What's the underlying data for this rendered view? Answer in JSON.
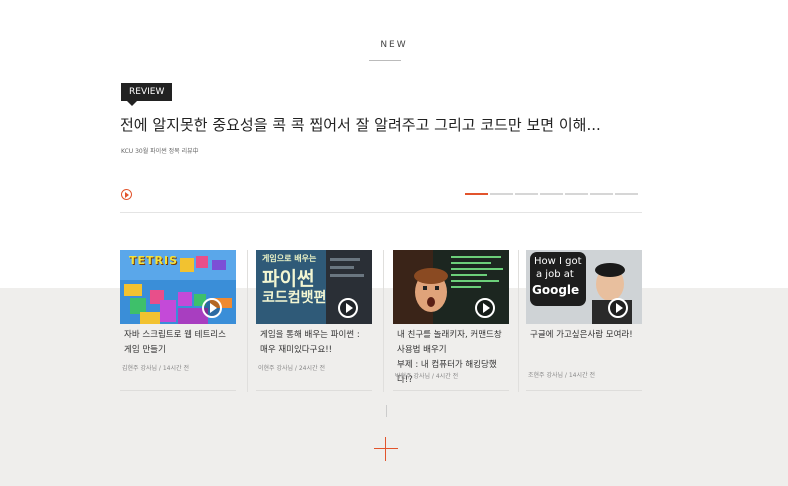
{
  "section": {
    "title": "NEW"
  },
  "featured": {
    "badge": "REVIEW",
    "headline": "전에 알지못한 중요성을 콕 콕 찝어서 잘 알려주고 그리고 코드만 보면 이해...",
    "meta": "KCU 30월 파이썬 정복 리뷰中"
  },
  "pager": {
    "pages": 7,
    "active": 0
  },
  "cards": [
    {
      "thumb_text": "TETRIS",
      "title_line1": "자바 스크립트로 웹 테트리스",
      "title_line2": "게임 만들기",
      "title_line3": "",
      "author": "김현주 강사님 / 14시간 전"
    },
    {
      "thumb_text_top": "게임으로 배우는",
      "thumb_text_main": "파이썬",
      "thumb_text_sub": "코드컴뱃편",
      "title_line1": "게임을 통해 배우는 파이썬 :",
      "title_line2": "매우 재미있다구요!!",
      "title_line3": "",
      "author": "이현주 강사님 / 24시간 전"
    },
    {
      "title_line1": "내 친구를 놀래키자, 커맨드창",
      "title_line2": "사용법 배우기",
      "title_line3": "부제 : 내 컴퓨터가 해킹당했다!?",
      "author": "박현주 강사님 / 4시간 전"
    },
    {
      "thumb_text_1": "How I got",
      "thumb_text_2": "a job at",
      "thumb_text_3": "Google",
      "title_line1": "구글에 가고싶은사람 모여라!",
      "title_line2": "",
      "title_line3": "",
      "author": "조현주 강사님 / 14시간 전"
    }
  ],
  "colors": {
    "accent": "#e2542c",
    "badge_bg": "#222222",
    "bottom_bg": "#efeeec"
  }
}
